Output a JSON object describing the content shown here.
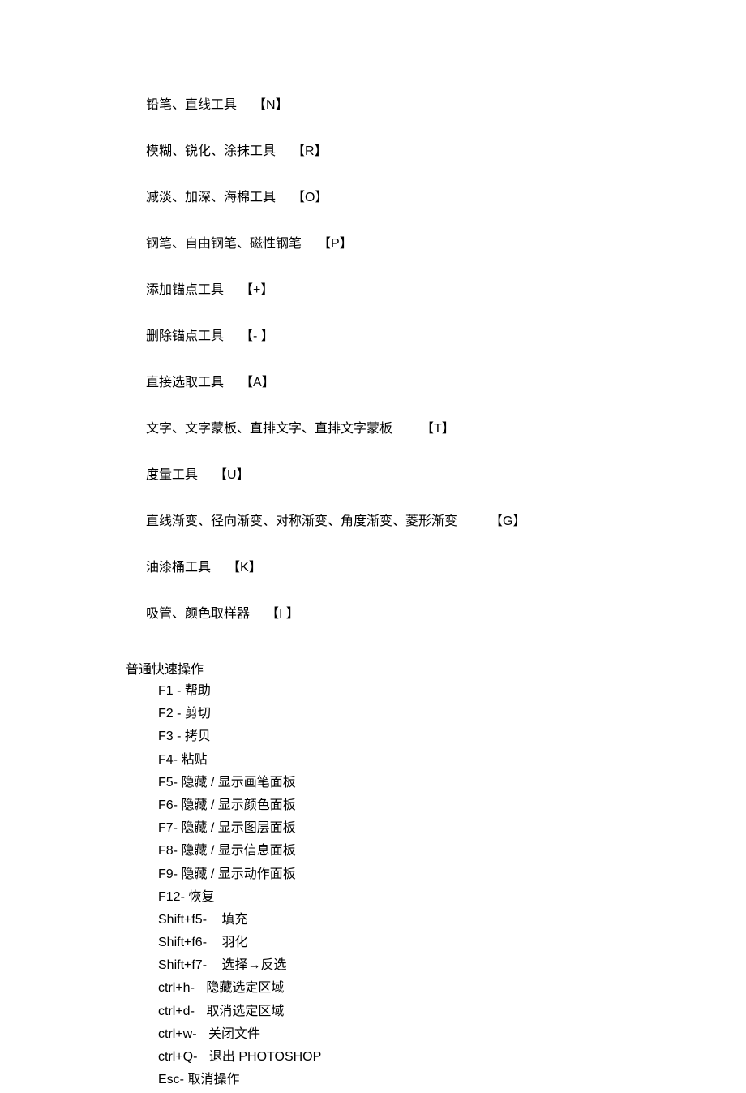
{
  "tool_shortcuts": [
    {
      "name": "铅笔、直线工具",
      "key": "【N】"
    },
    {
      "name": "模糊、锐化、涂抹工具",
      "key": "【R】"
    },
    {
      "name": "减淡、加深、海棉工具",
      "key": "【O】"
    },
    {
      "name": "钢笔、自由钢笔、磁性钢笔",
      "key": "【P】"
    },
    {
      "name": "添加锚点工具",
      "key": "【+】"
    },
    {
      "name": "删除锚点工具",
      "key": "【- 】"
    },
    {
      "name": "直接选取工具",
      "key": "【A】"
    },
    {
      "name": "文字、文字蒙板、直排文字、直排文字蒙板",
      "key": "【T】"
    },
    {
      "name": "度量工具",
      "key": "【U】"
    },
    {
      "name": "直线渐变、径向渐变、对称渐变、角度渐变、菱形渐变",
      "key": "【G】"
    },
    {
      "name": "油漆桶工具",
      "key": "【K】"
    },
    {
      "name": "吸管、颜色取样器",
      "key": "【I 】"
    }
  ],
  "quick_ops_title": "普通快速操作",
  "quick_ops": [
    {
      "key": "F1 -",
      "desc": "帮助"
    },
    {
      "key": "F2 -",
      "desc": "剪切"
    },
    {
      "key": "F3 -",
      "desc": "拷贝"
    },
    {
      "key": "F4-",
      "desc": "粘贴"
    },
    {
      "key": "F5-",
      "desc": "隐藏 / 显示画笔面板"
    },
    {
      "key": "F6-",
      "desc": "隐藏 / 显示颜色面板"
    },
    {
      "key": "F7-",
      "desc": "隐藏 / 显示图层面板"
    },
    {
      "key": "F8-",
      "desc": "隐藏 / 显示信息面板"
    },
    {
      "key": "F9-",
      "desc": "隐藏 / 显示动作面板"
    },
    {
      "key": "F12-",
      "desc": "恢复"
    },
    {
      "key": "Shift+f5-",
      "desc": "填充"
    },
    {
      "key": "Shift+f6-",
      "desc": "羽化"
    },
    {
      "key": "Shift+f7-",
      "desc": "选择→反选"
    },
    {
      "key": "ctrl+h-",
      "desc": "隐藏选定区域"
    },
    {
      "key": "ctrl+d-",
      "desc": "取消选定区域"
    },
    {
      "key": "ctrl+w-",
      "desc": "关闭文件"
    },
    {
      "key": "ctrl+Q-",
      "desc": "退出 PHOTOSHOP"
    },
    {
      "key": "Esc-",
      "desc": "取消操作"
    }
  ]
}
